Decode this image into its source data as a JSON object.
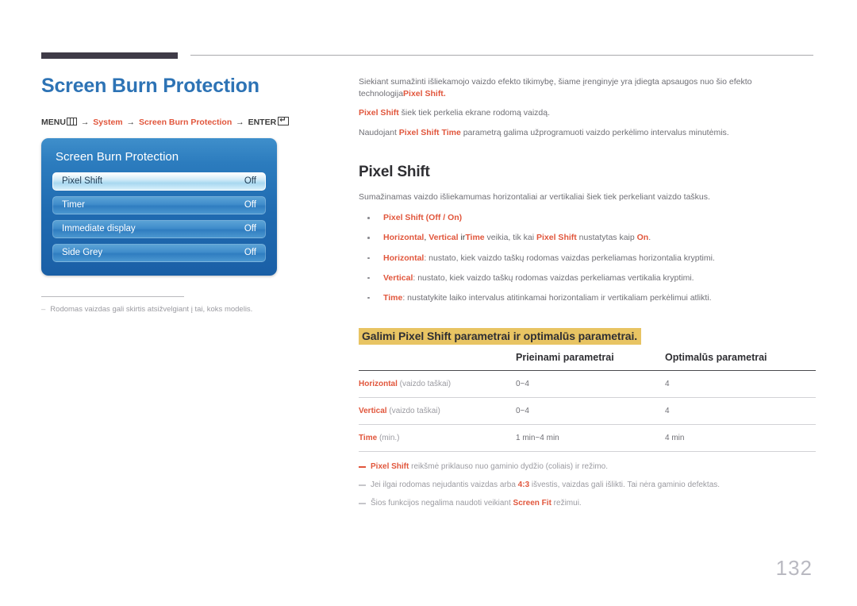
{
  "header": {
    "doc_title": "Screen Burn Protection",
    "breadcrumb": {
      "menu_label": "MENU",
      "menu_icon": "menu-grid-icon",
      "arrow": "→",
      "item1": "System",
      "item2": "Screen Burn Protection",
      "enter_label": "ENTER",
      "enter_icon": "enter-return-icon"
    }
  },
  "osd": {
    "title": "Screen Burn Protection",
    "rows": [
      {
        "label": "Pixel Shift",
        "value": "Off",
        "selected": true
      },
      {
        "label": "Timer",
        "value": "Off",
        "selected": false
      },
      {
        "label": "Immediate display",
        "value": "Off",
        "selected": false
      },
      {
        "label": "Side Grey",
        "value": "Off",
        "selected": false
      }
    ]
  },
  "left_note": {
    "dash": "–",
    "text": "Rodomas vaizdas gali skirtis atsižvelgiant į tai, koks modelis."
  },
  "intro": {
    "p1_a": "Siekiant sumažinti išliekamojo vaizdo efekto tikimybę, šiame įrenginyje yra įdiegta apsaugos nuo šio efekto technologija",
    "p1_b": "Pixel Shift",
    "p1_c": ".",
    "p2_a": "Pixel Shift",
    "p2_b": " šiek tiek perkelia ekrane rodomą vaizdą.",
    "p3_a": "Naudojant ",
    "p3_b": "Pixel Shift Time",
    "p3_c": " parametrą galima užprogramuoti vaizdo perkėlimo intervalus minutėmis."
  },
  "section": {
    "title": "Pixel Shift",
    "lead": "Sumažinamas vaizdo išliekamumas horizontaliai ar vertikaliai šiek tiek perkeliant vaizdo taškus.",
    "bullets": [
      {
        "term": "Pixel Shift",
        "rest": " (Off / On)",
        "opt1": "Off",
        "opt2": "On",
        "kind": "options"
      },
      {
        "kind": "subnote",
        "s1": "Horizontal",
        "s2": ", ",
        "s3": "Vertical",
        "s4": " ir",
        "s5": "Time",
        "s6": " veikia, tik kai ",
        "s7": "Pixel Shift",
        "s8": " nustatytas kaip ",
        "s9": "On",
        "s10": "."
      },
      {
        "term": "Horizontal",
        "rest": ": nustato, kiek vaizdo taškų rodomas vaizdas perkeliamas horizontalia kryptimi.",
        "kind": "plain"
      },
      {
        "term": "Vertical",
        "rest": ": nustato, kiek vaizdo taškų rodomas vaizdas perkeliamas vertikalia kryptimi.",
        "kind": "plain"
      },
      {
        "term": "Time",
        "rest": ": nustatykite laiko intervalus atitinkamai horizontaliam ir vertikaliam perkėlimui atlikti.",
        "kind": "plain"
      }
    ]
  },
  "table": {
    "caption": "Galimi Pixel Shift parametrai ir optimalūs parametrai.",
    "headers": [
      "",
      "Prieinami parametrai",
      "Optimalūs parametrai"
    ],
    "rows": [
      {
        "name": "Horizontal",
        "unit": " (vaizdo taškai)",
        "available": "0~4",
        "optimal": "4"
      },
      {
        "name": "Vertical",
        "unit": " (vaizdo taškai)",
        "available": "0~4",
        "optimal": "4"
      },
      {
        "name": "Time",
        "unit": " (min.)",
        "available": "1 min~4 min",
        "optimal": "4 min"
      }
    ]
  },
  "footnotes": [
    {
      "a": "Pixel Shift",
      "b": " reikšmė priklauso nuo gaminio dydžio (coliais) ir režimo.",
      "lead": ""
    },
    {
      "lead": "Jei ilgai rodomas nejudantis vaizdas arba ",
      "a": "4:3",
      "b": " išvestis, vaizdas gali išlikti. Tai nėra gaminio defektas."
    },
    {
      "lead": "Šios funkcijos negalima naudoti veikiant ",
      "a": "Screen Fit",
      "b": " režimui."
    }
  ],
  "page_number": "132",
  "colors": {
    "accent_orange": "#e1563c",
    "title_blue": "#2d73b5",
    "highlight_yellow": "#e8c463",
    "osd_blue": "#2c7cbe"
  }
}
